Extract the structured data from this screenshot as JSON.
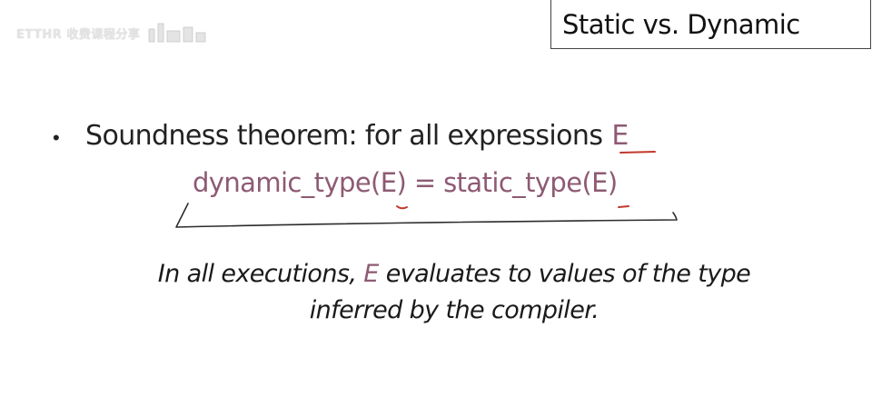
{
  "watermark": {
    "text": "ETTHR 收费课程分享"
  },
  "title": "Static vs. Dynamic",
  "bullet": {
    "text": "Soundness theorem: for all expressions",
    "variable": "E"
  },
  "equation": "dynamic_type(E) = static_type(E)",
  "explanation": {
    "line1_before": "In all executions,",
    "line1_var": "E",
    "line1_after": "evaluates to values of the type",
    "line2": "inferred by the compiler."
  },
  "colors": {
    "accent": "#8e5a73",
    "text": "#1a1a1a",
    "title_border": "#444444"
  }
}
